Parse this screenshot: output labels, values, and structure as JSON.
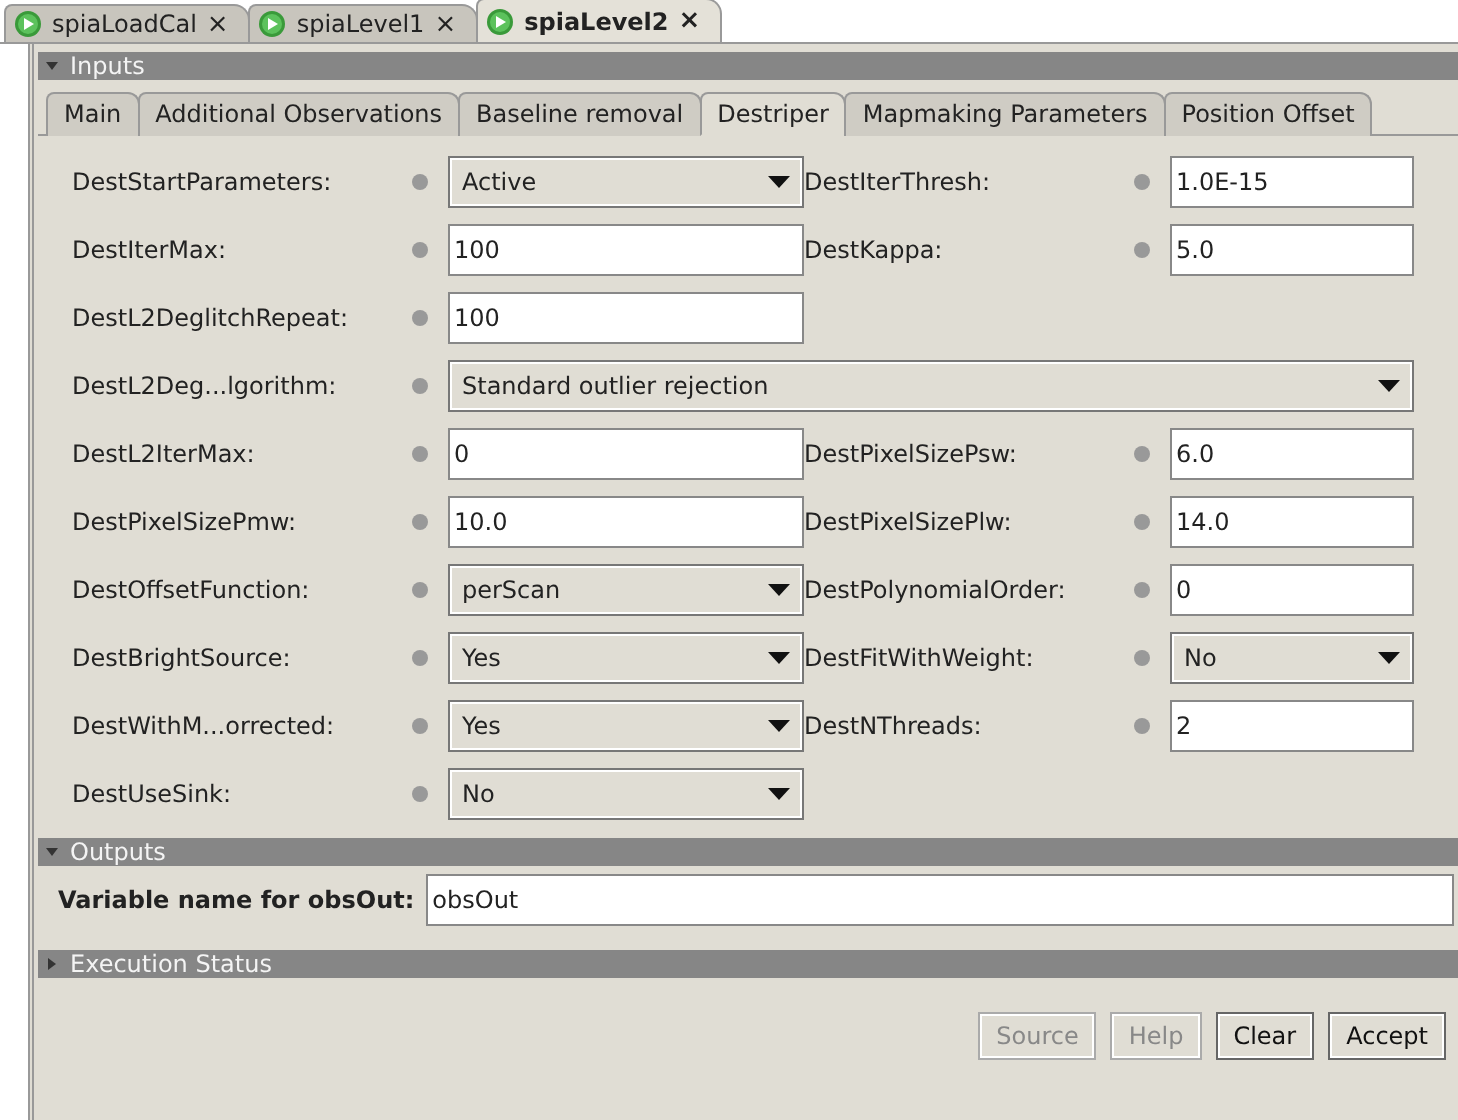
{
  "editor_tabs": [
    {
      "label": "spiaLoadCal",
      "close": "×",
      "selected": false
    },
    {
      "label": "spiaLevel1",
      "close": "×",
      "selected": false
    },
    {
      "label": "spiaLevel2",
      "close": "×",
      "selected": true
    }
  ],
  "inputs": {
    "title": "Inputs",
    "expanded": true,
    "tabs": [
      {
        "label": "Main",
        "selected": false
      },
      {
        "label": "Additional Observations",
        "selected": false
      },
      {
        "label": "Baseline removal",
        "selected": false
      },
      {
        "label": "Destriper",
        "selected": true
      },
      {
        "label": "Mapmaking Parameters",
        "selected": false
      },
      {
        "label": "Position Offset",
        "selected": false
      }
    ],
    "rows": [
      {
        "fields": [
          {
            "label": "DestStartParameters:",
            "kind": "combo",
            "value": "Active"
          },
          {
            "label": "DestIterThresh:",
            "kind": "text",
            "value": "1.0E-15"
          }
        ]
      },
      {
        "fields": [
          {
            "label": "DestIterMax:",
            "kind": "text",
            "value": "100"
          },
          {
            "label": "DestKappa:",
            "kind": "text",
            "value": "5.0"
          }
        ]
      },
      {
        "fields": [
          {
            "label": "DestL2DeglitchRepeat:",
            "kind": "text",
            "value": "100"
          }
        ]
      },
      {
        "fields": [
          {
            "label": "DestL2Deg...lgorithm:",
            "kind": "wide-combo",
            "value": "Standard outlier rejection"
          }
        ]
      },
      {
        "fields": [
          {
            "label": "DestL2IterMax:",
            "kind": "text",
            "value": "0"
          },
          {
            "label": "DestPixelSizePsw:",
            "kind": "text",
            "value": "6.0"
          }
        ]
      },
      {
        "fields": [
          {
            "label": "DestPixelSizePmw:",
            "kind": "text",
            "value": "10.0"
          },
          {
            "label": "DestPixelSizePlw:",
            "kind": "text",
            "value": "14.0"
          }
        ]
      },
      {
        "fields": [
          {
            "label": "DestOffsetFunction:",
            "kind": "combo",
            "value": "perScan"
          },
          {
            "label": "DestPolynomialOrder:",
            "kind": "text",
            "value": "0"
          }
        ]
      },
      {
        "fields": [
          {
            "label": "DestBrightSource:",
            "kind": "combo",
            "value": "Yes"
          },
          {
            "label": "DestFitWithWeight:",
            "kind": "combo",
            "value": "No"
          }
        ]
      },
      {
        "fields": [
          {
            "label": "DestWithM...orrected:",
            "kind": "combo",
            "value": "Yes"
          },
          {
            "label": "DestNThreads:",
            "kind": "text",
            "value": "2"
          }
        ]
      },
      {
        "fields": [
          {
            "label": "DestUseSink:",
            "kind": "combo",
            "value": "No"
          }
        ]
      }
    ]
  },
  "outputs": {
    "title": "Outputs",
    "expanded": true,
    "label": "Variable name for obsOut:",
    "value": "obsOut"
  },
  "execution_status": {
    "title": "Execution Status",
    "expanded": false
  },
  "buttons": [
    {
      "label": "Source",
      "disabled": true
    },
    {
      "label": "Help",
      "disabled": true
    },
    {
      "label": "Clear",
      "disabled": false
    },
    {
      "label": "Accept",
      "disabled": false
    }
  ]
}
